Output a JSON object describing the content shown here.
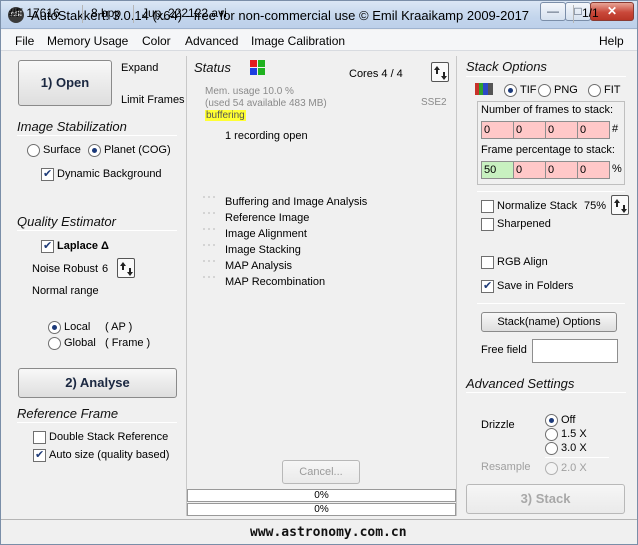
{
  "window": {
    "title": "AutoStakkert! 3.0.14 (x64) - free for non-commercial use © Emil Kraaikamp 2009-2017",
    "app_icon_text": "AS!",
    "buttons": {
      "minimize": "—",
      "maximize": "□",
      "close": "✕"
    }
  },
  "menu": {
    "items": [
      "File",
      "Memory Usage",
      "Color",
      "Advanced",
      "Image Calibration"
    ],
    "help": "Help"
  },
  "left": {
    "open_label": "1) Open",
    "expand_label": "Expand",
    "limit_frames_label": "Limit Frames",
    "stabilization": {
      "title": "Image Stabilization",
      "surface_label": "Surface",
      "planet_label": "Planet (COG)",
      "dynamic_bg_label": "Dynamic Background"
    },
    "quality": {
      "title": "Quality Estimator",
      "laplace_label": "Laplace Δ",
      "noise_robust_label": "Noise Robust",
      "noise_robust_value": "6",
      "normal_range_label": "Normal range",
      "local_label": "Local",
      "local_suffix": "( AP )",
      "global_label": "Global",
      "global_suffix": "( Frame )"
    },
    "analyse_label": "2) Analyse",
    "reference": {
      "title": "Reference Frame",
      "double_stack_label": "Double Stack Reference",
      "auto_size_label": "Auto size (quality based)"
    }
  },
  "status": {
    "title": "Status",
    "cores": "Cores 4 / 4",
    "memory_line1": "Mem. usage 10.0 %",
    "memory_line2": "(used 54 available 483 MB)",
    "sse": "SSE2",
    "buffering": "buffering",
    "recording": "1 recording open",
    "steps": [
      "Buffering and Image Analysis",
      "Reference Image",
      "Image Alignment",
      "Image Stacking",
      "MAP Analysis",
      "MAP Recombination"
    ],
    "cancel_label": "Cancel...",
    "progress1": "0%",
    "progress2": "0%",
    "color_green": "#1fb21f",
    "color_red": "#e21e1e",
    "color_blue": "#1e3fe0"
  },
  "stack": {
    "title": "Stack Options",
    "tif_label": "TIF",
    "png_label": "PNG",
    "fit_label": "FIT",
    "num_frames_label": "Number of frames to stack:",
    "num_frames_values": [
      "0",
      "0",
      "0",
      "0"
    ],
    "num_frames_suffix": "#",
    "pct_label": "Frame percentage to stack:",
    "pct_values": [
      "50",
      "0",
      "0",
      "0"
    ],
    "pct_suffix": "%",
    "normalize_label": "Normalize Stack",
    "normalize_value": "75%",
    "sharpened_label": "Sharpened",
    "rgb_align_label": "RGB Align",
    "save_folders_label": "Save in Folders",
    "stackname_label": "Stack(name) Options",
    "free_field_label": "Free field",
    "free_field_value": "",
    "advanced_title": "Advanced Settings",
    "drizzle_label": "Drizzle",
    "drizzle_off": "Off",
    "drizzle_15": "1.5 X",
    "drizzle_30": "3.0 X",
    "resample_label": "Resample",
    "resample_20": "2.0 X",
    "stack_button_label": "3) Stack"
  },
  "statusbar": {
    "frames": "#F 17616",
    "bpp": "8 bpp",
    "file": "Jup_222122.avi",
    "watermark": "www.astronomy.com.cn",
    "page": "1/1"
  }
}
